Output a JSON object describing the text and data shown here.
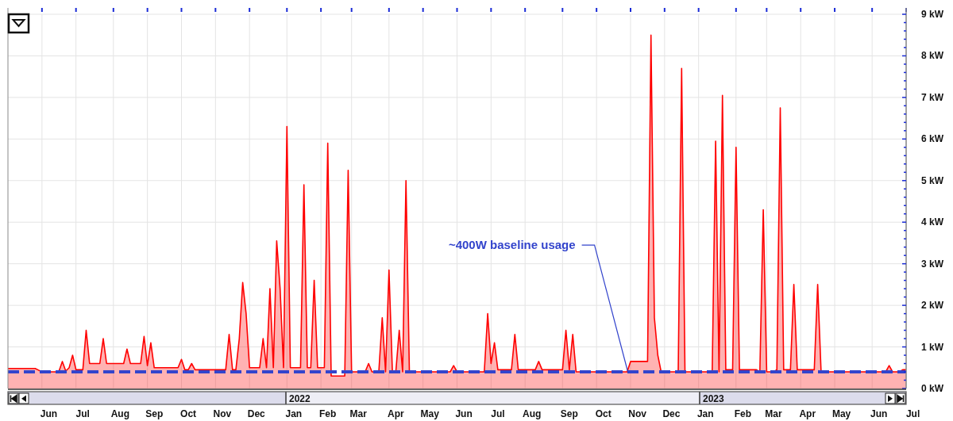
{
  "chart": {
    "chart_data": {
      "type": "area",
      "ylim": [
        0,
        9
      ],
      "yticks": [
        {
          "value": 0,
          "label": "0 kW"
        },
        {
          "value": 1,
          "label": "1 kW"
        },
        {
          "value": 2,
          "label": "2 kW"
        },
        {
          "value": 3,
          "label": "3 kW"
        },
        {
          "value": 4,
          "label": "4 kW"
        },
        {
          "value": 5,
          "label": "5 kW"
        },
        {
          "value": 6,
          "label": "6 kW"
        },
        {
          "value": 7,
          "label": "7 kW"
        },
        {
          "value": 8,
          "label": "8 kW"
        },
        {
          "value": 9,
          "label": "9 kW"
        }
      ],
      "grid": true,
      "categories": [
        null,
        null,
        null,
        null,
        null,
        null,
        null,
        null,
        null,
        null,
        null,
        null,
        "Jun",
        null,
        null,
        null,
        null,
        null,
        null,
        null,
        null,
        null,
        "Jul",
        null,
        null,
        null,
        null,
        null,
        null,
        null,
        null,
        null,
        null,
        "Aug",
        null,
        null,
        null,
        null,
        null,
        null,
        null,
        null,
        null,
        "Sep",
        null,
        null,
        null,
        null,
        null,
        null,
        null,
        null,
        null,
        "Oct",
        null,
        null,
        null,
        null,
        null,
        null,
        null,
        null,
        null,
        "Nov",
        null,
        null,
        null,
        null,
        null,
        null,
        null,
        null,
        null,
        "Dec",
        null,
        null,
        null,
        null,
        null,
        null,
        null,
        null,
        null,
        null,
        "Jan",
        null,
        null,
        null,
        null,
        null,
        null,
        null,
        null,
        null,
        "Feb",
        null,
        null,
        null,
        null,
        null,
        null,
        null,
        null,
        "Mar",
        null,
        null,
        null,
        null,
        null,
        null,
        null,
        null,
        null,
        null,
        "Apr",
        null,
        null,
        null,
        null,
        null,
        null,
        null,
        null,
        null,
        "May",
        null,
        null,
        null,
        null,
        null,
        null,
        null,
        null,
        null,
        "Jun",
        null,
        null,
        null,
        null,
        null,
        null,
        null,
        null,
        null,
        "Jul",
        null,
        null,
        null,
        null,
        null,
        null,
        null,
        null,
        null,
        "Aug",
        null,
        null,
        null,
        null,
        null,
        null,
        null,
        null,
        null,
        null,
        "Sep",
        null,
        null,
        null,
        null,
        null,
        null,
        null,
        null,
        null,
        "Oct",
        null,
        null,
        null,
        null,
        null,
        null,
        null,
        null,
        null,
        "Nov",
        null,
        null,
        null,
        null,
        null,
        null,
        null,
        null,
        null,
        "Dec",
        null,
        null,
        null,
        null,
        null,
        null,
        null,
        null,
        null,
        "Jan",
        null,
        null,
        null,
        null,
        null,
        null,
        null,
        null,
        null,
        null,
        "Feb",
        null,
        null,
        null,
        null,
        null,
        null,
        null,
        null,
        "Mar",
        null,
        null,
        null,
        null,
        null,
        null,
        null,
        null,
        null,
        "Apr",
        null,
        null,
        null,
        null,
        null,
        null,
        null,
        null,
        null,
        "May",
        null,
        null,
        null,
        null,
        null,
        null,
        null,
        null,
        null,
        null,
        "Jun",
        null,
        null,
        null,
        null,
        null,
        null,
        null,
        null,
        null,
        "Jul"
      ],
      "series": [
        {
          "color": "#ff0000",
          "values": [
            0.48,
            0.48,
            0.48,
            0.48,
            0.48,
            0.48,
            0.48,
            0.48,
            0.48,
            0.44,
            0.4,
            0.4,
            0.4,
            0.4,
            0.4,
            0.42,
            0.65,
            0.42,
            0.5,
            0.8,
            0.45,
            0.45,
            0.45,
            1.4,
            0.6,
            0.6,
            0.6,
            0.6,
            1.2,
            0.6,
            0.6,
            0.6,
            0.6,
            0.6,
            0.6,
            0.95,
            0.6,
            0.6,
            0.6,
            0.6,
            1.25,
            0.55,
            1.1,
            0.5,
            0.5,
            0.5,
            0.5,
            0.5,
            0.5,
            0.5,
            0.5,
            0.7,
            0.45,
            0.45,
            0.6,
            0.45,
            0.45,
            0.45,
            0.45,
            0.45,
            0.45,
            0.45,
            0.45,
            0.45,
            0.45,
            1.3,
            0.45,
            0.45,
            1.2,
            2.55,
            1.8,
            0.5,
            0.5,
            0.5,
            0.5,
            1.2,
            0.5,
            2.4,
            0.5,
            3.55,
            2.4,
            0.5,
            6.3,
            0.5,
            0.5,
            0.5,
            0.5,
            4.9,
            0.5,
            0.5,
            2.6,
            0.5,
            0.5,
            0.5,
            5.9,
            0.3,
            0.3,
            0.3,
            0.3,
            0.3,
            5.25,
            0.4,
            0.4,
            0.4,
            0.4,
            0.4,
            0.6,
            0.4,
            0.4,
            0.4,
            1.7,
            0.4,
            2.85,
            0.4,
            0.4,
            1.4,
            0.4,
            5.0,
            0.4,
            0.4,
            0.4,
            0.4,
            0.4,
            0.4,
            0.4,
            0.4,
            0.4,
            0.4,
            0.4,
            0.4,
            0.4,
            0.55,
            0.4,
            0.4,
            0.4,
            0.4,
            0.4,
            0.4,
            0.4,
            0.4,
            0.4,
            1.8,
            0.6,
            1.1,
            0.45,
            0.45,
            0.45,
            0.45,
            0.45,
            1.3,
            0.45,
            0.45,
            0.45,
            0.45,
            0.45,
            0.45,
            0.65,
            0.45,
            0.45,
            0.45,
            0.45,
            0.45,
            0.45,
            0.45,
            1.4,
            0.45,
            1.3,
            0.4,
            0.4,
            0.4,
            0.4,
            0.4,
            0.4,
            0.4,
            0.4,
            0.4,
            0.4,
            0.4,
            0.4,
            0.4,
            0.4,
            0.4,
            0.4,
            0.65,
            0.65,
            0.65,
            0.65,
            0.65,
            0.65,
            8.5,
            1.7,
            0.8,
            0.4,
            0.4,
            0.4,
            0.4,
            0.4,
            0.4,
            7.7,
            0.4,
            0.4,
            0.4,
            0.4,
            0.4,
            0.4,
            0.4,
            0.4,
            0.4,
            5.95,
            0.4,
            7.05,
            0.45,
            0.45,
            0.45,
            5.8,
            0.45,
            0.45,
            0.45,
            0.45,
            0.45,
            0.45,
            0.4,
            4.3,
            0.4,
            0.4,
            0.4,
            0.45,
            6.75,
            0.45,
            0.45,
            0.45,
            2.5,
            0.45,
            0.45,
            0.45,
            0.45,
            0.45,
            0.45,
            2.5,
            0.4,
            0.4,
            0.4,
            0.4,
            0.4,
            0.4,
            0.4,
            0.4,
            0.4,
            0.4,
            0.4,
            0.4,
            0.4,
            0.4,
            0.4,
            0.4,
            0.4,
            0.4,
            0.4,
            0.4,
            0.55,
            0.4,
            0.4,
            0.4,
            0.45,
            0.45,
            null,
            null
          ]
        }
      ],
      "ref_lines": [
        {
          "axis": "y",
          "value": 0.4
        }
      ],
      "annotations": [
        "~400W baseline usage"
      ]
    },
    "navigator": {
      "years": [
        {
          "label": "2022"
        },
        {
          "label": "2023"
        }
      ]
    }
  }
}
